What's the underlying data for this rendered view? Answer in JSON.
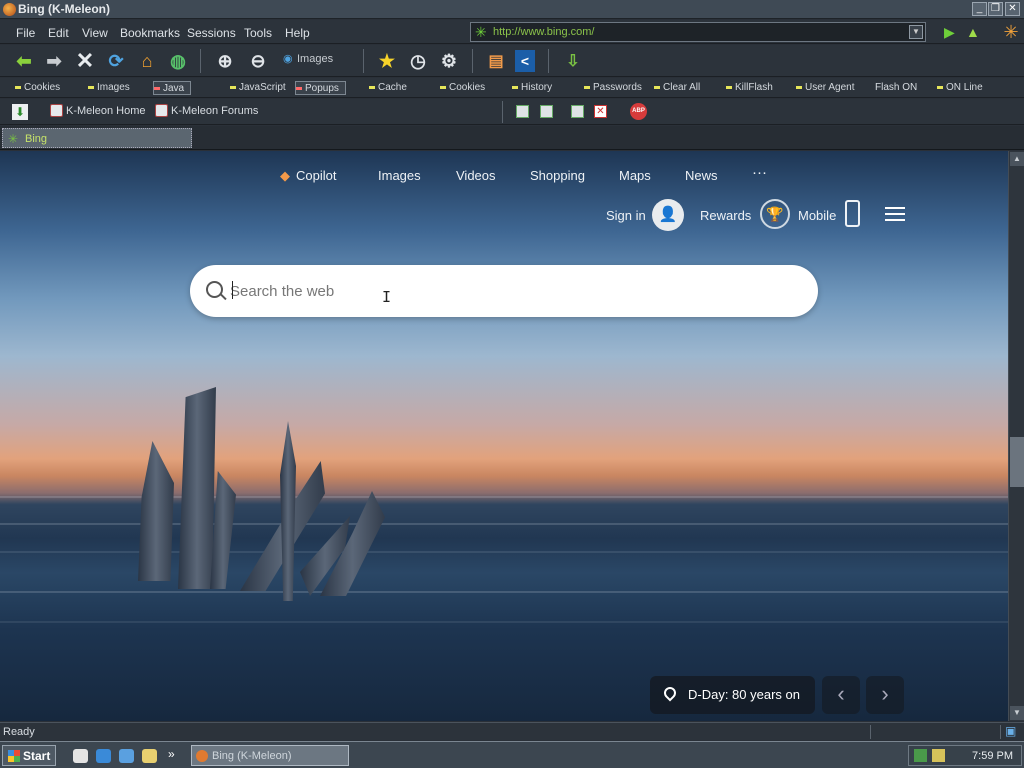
{
  "window": {
    "title": "Bing (K-Meleon)"
  },
  "menu": [
    "File",
    "Edit",
    "View",
    "Bookmarks",
    "Sessions",
    "Tools",
    "Help"
  ],
  "address": {
    "url": "http://www.bing.com/"
  },
  "navbar": {
    "images_label": "Images"
  },
  "flags": [
    "Cookies",
    "Images",
    "Java",
    "JavaScript",
    "Popups",
    "Cache",
    "Cookies",
    "History",
    "Passwords",
    "Clear All",
    "KillFlash",
    "User Agent",
    "Flash ON",
    "ON Line"
  ],
  "links": {
    "home": "K-Meleon Home",
    "forums": "K-Meleon Forums"
  },
  "tab": {
    "label": "Bing"
  },
  "bing": {
    "nav": [
      "Copilot",
      "Images",
      "Videos",
      "Shopping",
      "Maps",
      "News",
      "···"
    ],
    "sign_in": "Sign in",
    "rewards": "Rewards",
    "mobile": "Mobile",
    "search_placeholder": "Search the web",
    "caption": "D-Day: 80 years on"
  },
  "status": {
    "text": "Ready"
  },
  "taskbar": {
    "start": "Start",
    "app": "Bing (K-Meleon)",
    "clock": "7:59 PM"
  },
  "colors": {
    "url_text": "#8bc34a",
    "tab_text": "#c6e36a",
    "accent_green": "#6fcf3a"
  }
}
